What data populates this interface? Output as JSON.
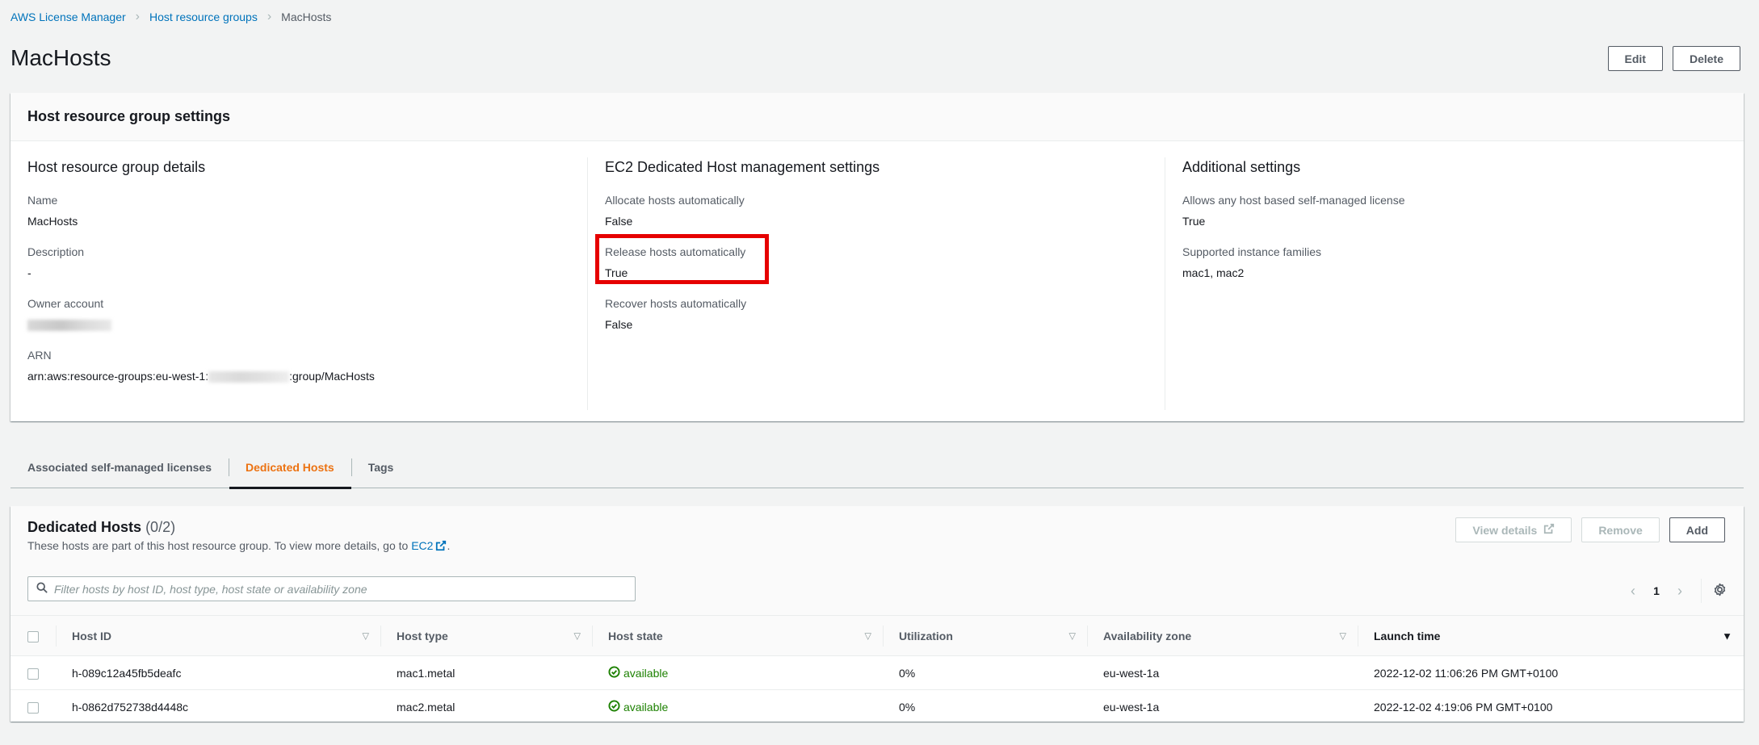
{
  "breadcrumb": {
    "items": [
      {
        "label": "AWS License Manager"
      },
      {
        "label": "Host resource groups"
      },
      {
        "label": "MacHosts"
      }
    ]
  },
  "page": {
    "title": "MacHosts",
    "edit_label": "Edit",
    "delete_label": "Delete"
  },
  "settings": {
    "title": "Host resource group settings",
    "details": {
      "heading": "Host resource group details",
      "name_label": "Name",
      "name_value": "MacHosts",
      "description_label": "Description",
      "description_value": "-",
      "owner_label": "Owner account",
      "arn_label": "ARN",
      "arn_prefix": "arn:aws:resource-groups:eu-west-1:",
      "arn_suffix": ":group/MacHosts"
    },
    "ec2": {
      "heading": "EC2 Dedicated Host management settings",
      "allocate_label": "Allocate hosts automatically",
      "allocate_value": "False",
      "release_label": "Release hosts automatically",
      "release_value": "True",
      "recover_label": "Recover hosts automatically",
      "recover_value": "False"
    },
    "additional": {
      "heading": "Additional settings",
      "allows_label": "Allows any host based self-managed license",
      "allows_value": "True",
      "families_label": "Supported instance families",
      "families_value": "mac1, mac2"
    }
  },
  "tabs": [
    {
      "label": "Associated self-managed licenses",
      "active": false
    },
    {
      "label": "Dedicated Hosts",
      "active": true
    },
    {
      "label": "Tags",
      "active": false
    }
  ],
  "hosts": {
    "title": "Dedicated Hosts",
    "count": "(0/2)",
    "description": "These hosts are part of this host resource group. To view more details, go to ",
    "ec2_link": "EC2",
    "description_end": ".",
    "view_details_label": "View details",
    "remove_label": "Remove",
    "add_label": "Add",
    "filter_placeholder": "Filter hosts by host ID, host type, host state or availability zone",
    "filter_value": "",
    "page_number": "1",
    "columns": [
      "Host ID",
      "Host type",
      "Host state",
      "Utilization",
      "Availability zone",
      "Launch time"
    ],
    "rows": [
      {
        "host_id": "h-089c12a45fb5deafc",
        "host_type": "mac1.metal",
        "host_state": "available",
        "utilization": "0%",
        "az": "eu-west-1a",
        "launch_time": "2022-12-02 11:06:26 PM GMT+0100"
      },
      {
        "host_id": "h-0862d752738d4448c",
        "host_type": "mac2.metal",
        "host_state": "available",
        "utilization": "0%",
        "az": "eu-west-1a",
        "launch_time": "2022-12-02 4:19:06 PM GMT+0100"
      }
    ]
  },
  "colors": {
    "link": "#0073bb",
    "active_tab": "#ec7211",
    "status_ok": "#1d8102",
    "highlight": "#e60000"
  }
}
